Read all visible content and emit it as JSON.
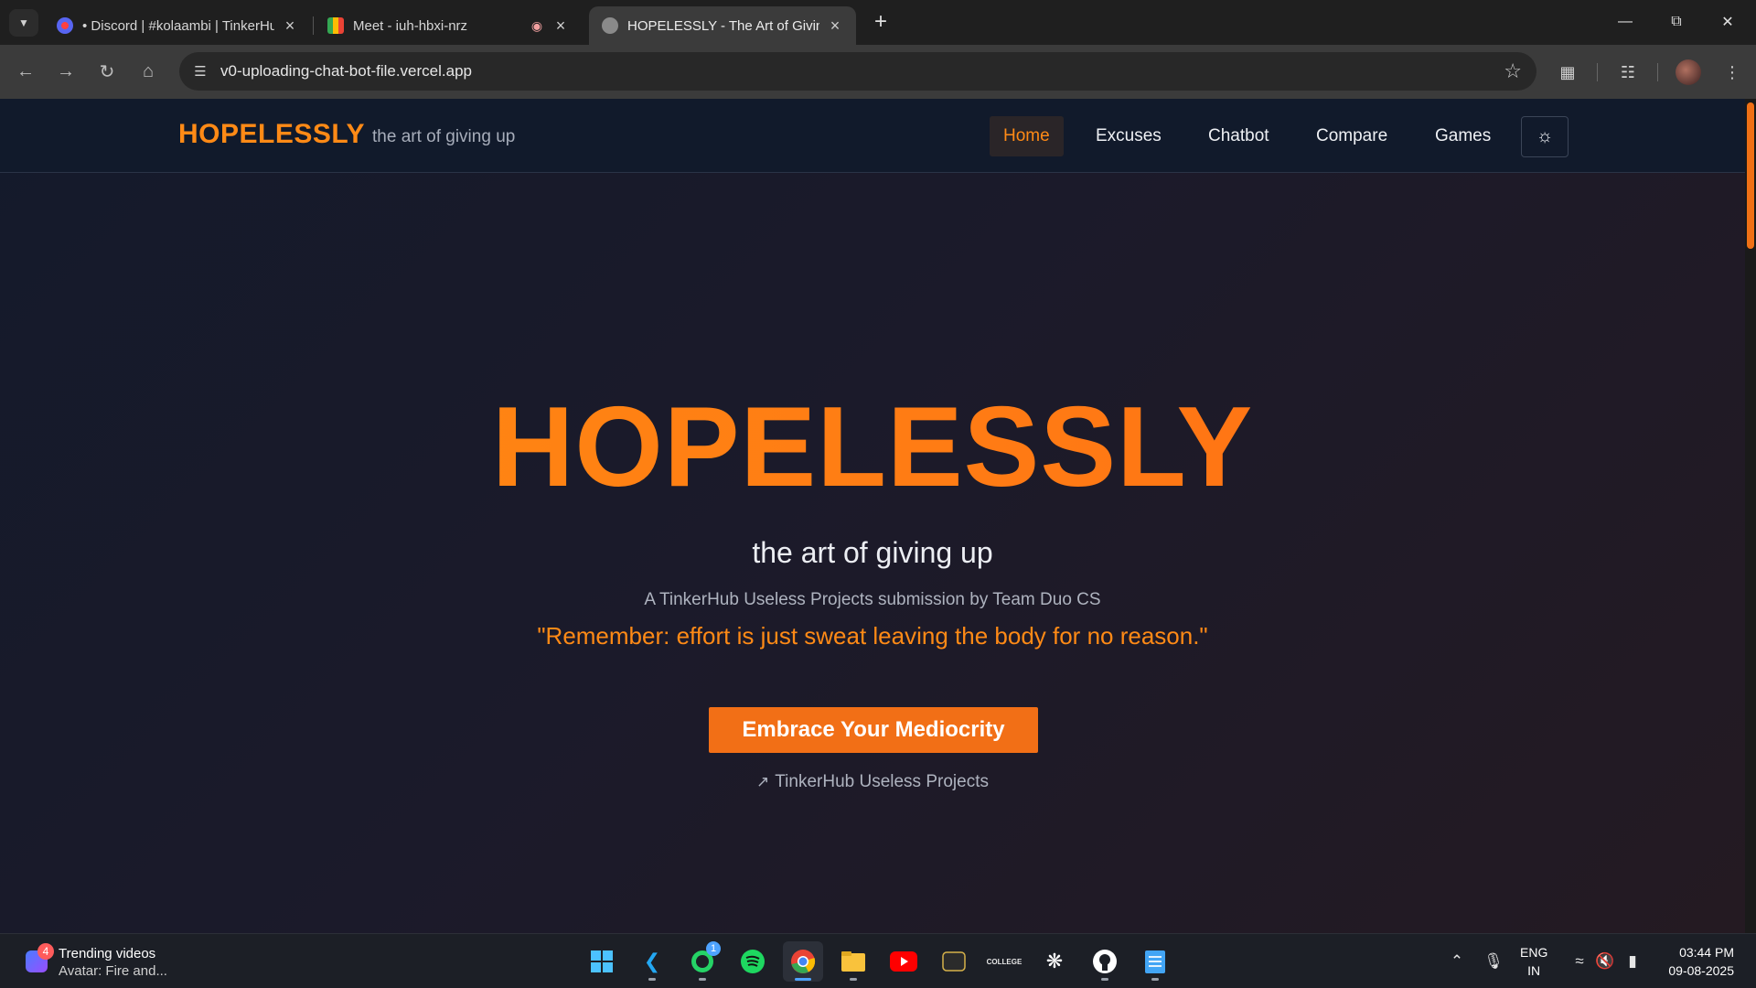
{
  "browser": {
    "tabs": [
      {
        "title": "• Discord | #kolaambi | TinkerHub",
        "active": false
      },
      {
        "title": "Meet - iuh-hbxi-nrz",
        "active": false
      },
      {
        "title": "HOPELESSLY - The Art of Giving Up",
        "active": true
      }
    ],
    "new_tab_symbol": "+",
    "url": "v0-uploading-chat-bot-file.vercel.app"
  },
  "site": {
    "brand": "HOPELESSLY",
    "tagline": "the art of giving up",
    "nav": [
      {
        "label": "Home",
        "active": true
      },
      {
        "label": "Excuses",
        "active": false
      },
      {
        "label": "Chatbot",
        "active": false
      },
      {
        "label": "Compare",
        "active": false
      },
      {
        "label": "Games",
        "active": false
      }
    ],
    "hero": {
      "title": "HOPELESSLY",
      "subtitle": "the art of giving up",
      "credit": "A TinkerHub Useless Projects submission by Team Duo CS",
      "quote": "\"Remember: effort is just sweat leaving the body for no reason.\"",
      "cta_label": "Embrace Your Mediocrity",
      "link_label": "TinkerHub Useless Projects"
    },
    "colors": {
      "accent": "#ff8a16",
      "cta": "#f26f16",
      "header_bg": "#111a2b"
    }
  },
  "taskbar": {
    "widget": {
      "badge": "4",
      "title": "Trending videos",
      "subtitle": "Avatar: Fire and..."
    },
    "apps": [
      {
        "name": "windows-start-icon"
      },
      {
        "name": "vscode-icon"
      },
      {
        "name": "whatsapp-icon",
        "badge": "1"
      },
      {
        "name": "spotify-icon"
      },
      {
        "name": "chrome-icon"
      },
      {
        "name": "file-explorer-icon"
      },
      {
        "name": "youtube-icon"
      },
      {
        "name": "app-icon"
      },
      {
        "name": "college-app-icon",
        "label": "COLLEGE"
      },
      {
        "name": "chatgpt-icon"
      },
      {
        "name": "github-icon"
      },
      {
        "name": "notepad-icon"
      }
    ],
    "language": {
      "line1": "ENG",
      "line2": "IN"
    },
    "clock": {
      "time": "03:44 PM",
      "date": "09-08-2025"
    }
  }
}
